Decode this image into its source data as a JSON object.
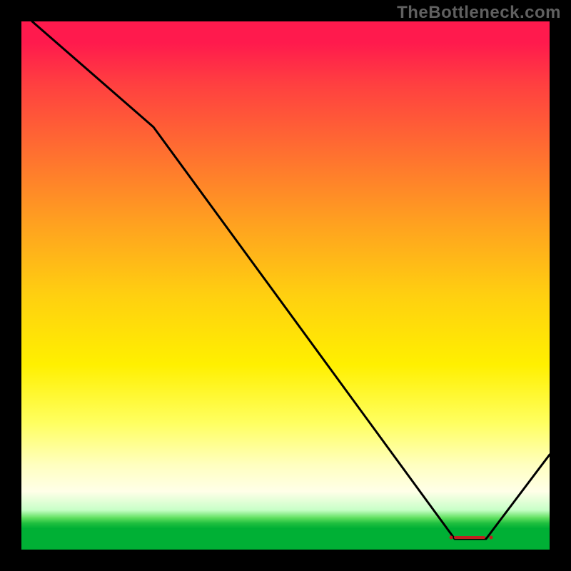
{
  "watermark": "TheBottleneck.com",
  "chart_data": {
    "type": "line",
    "title": "",
    "xlabel": "",
    "ylabel": "",
    "xlim": [
      0,
      100
    ],
    "ylim": [
      0,
      100
    ],
    "series": [
      {
        "name": "curve",
        "x": [
          2,
          25,
          82,
          88,
          100
        ],
        "values": [
          100,
          80,
          2,
          2,
          18
        ]
      }
    ],
    "markers": {
      "name": "bottom-marker-cluster",
      "approx_x": 85,
      "approx_y": 2
    },
    "background_gradient": {
      "top": "#ff1a4d",
      "upper_mid": "#ffa020",
      "mid": "#fff000",
      "lower": "#ffffe8",
      "bottom_band": "#00b035"
    }
  }
}
